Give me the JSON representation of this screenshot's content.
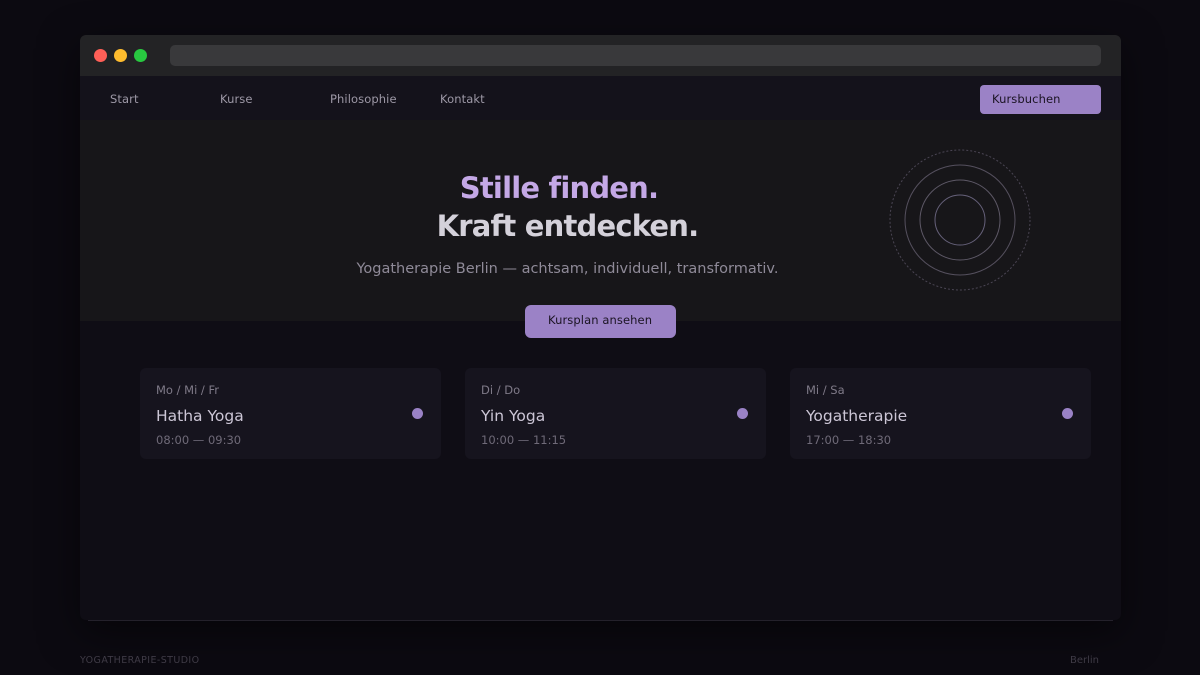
{
  "nav": {
    "items": [
      {
        "label": "Start"
      },
      {
        "label": "Kurse"
      },
      {
        "label": "Philosophie"
      },
      {
        "label": "Kontakt"
      }
    ],
    "cta_label": "Kursbuchen"
  },
  "hero": {
    "headline_line1": "Stille finden.",
    "headline_line2": "Kraft entdecken.",
    "subtitle": "Yogatherapie Berlin — achtsam, individuell, transformativ.",
    "cta_label": "Kursplan ansehen"
  },
  "courses": [
    {
      "days": "Mo / Mi / Fr",
      "title": "Hatha Yoga",
      "time": "08:00 — 09:30"
    },
    {
      "days": "Di / Do",
      "title": "Yin Yoga",
      "time": "10:00 — 11:15"
    },
    {
      "days": "Mi / Sa",
      "title": "Yogatherapie",
      "time": "17:00 — 18:30"
    }
  ],
  "footer": {
    "left": "YOGATHERAPIE-STUDIO",
    "right": "Berlin"
  },
  "colors": {
    "accent": "#9b82c6",
    "headline_accent": "#c4a8e6",
    "page_bg": "#0c0a11",
    "hero_bg": "#171619",
    "card_bg": "#16141e"
  },
  "icons": [
    "concentric-rings-icon",
    "course-indicator-dot"
  ]
}
